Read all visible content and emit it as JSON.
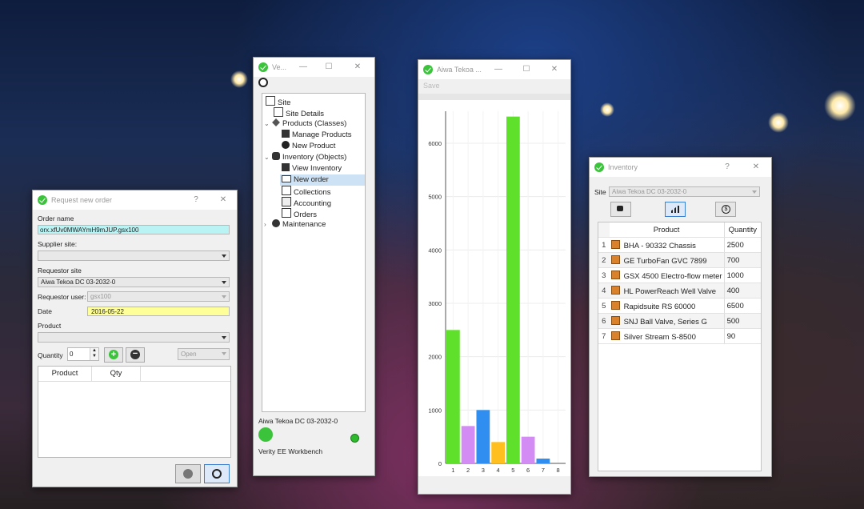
{
  "colors": {
    "accent": "#3cc33c",
    "highlight_cyan": "#b9f3f3",
    "highlight_yellow": "#ffff99",
    "selection": "#cde3f5"
  },
  "order_window": {
    "title": "Request new order",
    "help": "?",
    "close": "✕",
    "order_name_label": "Order name",
    "order_name_value": "orx.xfUv0MWAYmH9mJUP.gsx100",
    "supplier_site_label": "Supplier site:",
    "supplier_site_value": "",
    "requestor_site_label": "Requestor site",
    "requestor_site_value": "Aiwa Tekoa DC 03-2032-0",
    "requestor_user_label": "Requestor user:",
    "requestor_user_value": "gsx100",
    "date_label": "Date",
    "date_value": "2016-05-22",
    "product_label": "Product",
    "product_value": "",
    "quantity_label": "Quantity",
    "quantity_value": "0",
    "status_value": "Open",
    "table_headers": [
      "Product",
      "Qty"
    ]
  },
  "verity_window": {
    "title": "Ve...",
    "minimize": "—",
    "maximize": "☐",
    "close": "✕",
    "tree": {
      "site": "Site",
      "site_details": "Site Details",
      "products": "Products (Classes)",
      "manage_products": "Manage Products",
      "new_product": "New Product",
      "inventory": "Inventory (Objects)",
      "view_inventory": "View Inventory",
      "new_order": "New order",
      "collections": "Collections",
      "accounting": "Accounting",
      "orders": "Orders",
      "maintenance": "Maintenance"
    },
    "footer_site": "Aiwa Tekoa DC 03-2032-0",
    "footer_app": "Verity EE Workbench"
  },
  "chart_window": {
    "title": "Aiwa Tekoa ...",
    "minimize": "—",
    "maximize": "☐",
    "close": "✕",
    "save": "Save"
  },
  "chart_data": {
    "type": "bar",
    "categories": [
      "1",
      "2",
      "3",
      "4",
      "5",
      "6",
      "7",
      "8"
    ],
    "values": [
      2500,
      700,
      1000,
      400,
      6500,
      500,
      90,
      0
    ],
    "bar_colors": [
      "#5fe02a",
      "#d48cf5",
      "#2f8ef0",
      "#ffbf1f",
      "#5fe02a",
      "#d48cf5",
      "#2f8ef0",
      "#ffbf1f"
    ],
    "ylim": [
      0,
      6600
    ],
    "yticks": [
      0,
      1000,
      2000,
      3000,
      4000,
      5000,
      6000
    ],
    "grid": true,
    "title": "",
    "xlabel": "",
    "ylabel": ""
  },
  "inventory_window": {
    "title": "Inventory",
    "help": "?",
    "close": "✕",
    "site_label": "Site",
    "site_value": "Aiwa Tekoa DC 03-2032-0",
    "headers": [
      "Product",
      "Quantity"
    ],
    "rows": [
      {
        "n": "1",
        "product": "BHA - 90332 Chassis",
        "qty": "2500"
      },
      {
        "n": "2",
        "product": "GE TurboFan GVC 7899",
        "qty": "700"
      },
      {
        "n": "3",
        "product": "GSX 4500 Electro-flow meter",
        "qty": "1000"
      },
      {
        "n": "4",
        "product": "HL PowerReach Well Valve",
        "qty": "400"
      },
      {
        "n": "5",
        "product": "Rapidsuite RS 60000",
        "qty": "6500"
      },
      {
        "n": "6",
        "product": "SNJ Ball Valve, Series G",
        "qty": "500"
      },
      {
        "n": "7",
        "product": "Silver Stream S-8500",
        "qty": "90"
      }
    ]
  }
}
